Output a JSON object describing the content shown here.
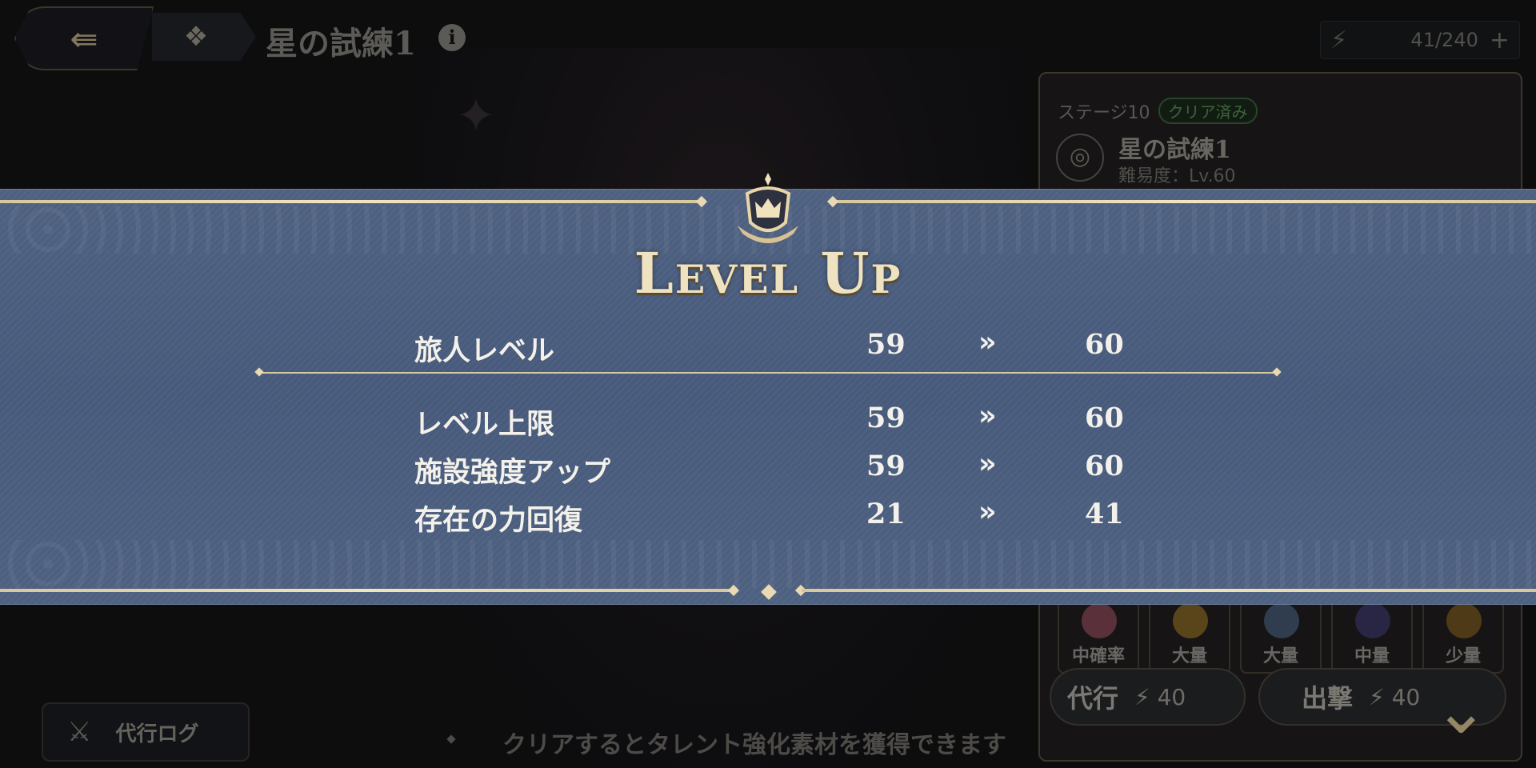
{
  "header": {
    "back_icon": "back-arrow-icon",
    "menu_icon": "grid-menu-icon",
    "title": "星の試練1",
    "info_icon": "info-icon",
    "stamina": {
      "icon": "lightning-icon",
      "value": "41/240",
      "plus": "+"
    }
  },
  "stage_panel": {
    "stage_label": "ステージ10",
    "status_badge": "クリア済み",
    "name": "星の試練1",
    "difficulty": "難易度：Lv.60",
    "rewards": [
      {
        "label": "中確率",
        "color": "#8b4b5a"
      },
      {
        "label": "大量",
        "color": "#8a6a2a"
      },
      {
        "label": "大量",
        "color": "#4a5e78"
      },
      {
        "label": "中量",
        "color": "#3e3a6a"
      },
      {
        "label": "少量",
        "color": "#7a5a24"
      }
    ],
    "auto_button": {
      "label": "代行",
      "cost": "40"
    },
    "sortie_button": {
      "label": "出撃",
      "cost": "40"
    }
  },
  "bottom": {
    "log_button": "代行ログ",
    "hint": "クリアするとタレント強化素材を獲得できます"
  },
  "level_up": {
    "title": "Level Up",
    "rows": [
      {
        "label": "旅人レベル",
        "from": "59",
        "to": "60"
      },
      {
        "label": "レベル上限",
        "from": "59",
        "to": "60"
      },
      {
        "label": "施設強度アップ",
        "from": "59",
        "to": "60"
      },
      {
        "label": "存在の力回復",
        "from": "21",
        "to": "41"
      }
    ],
    "arrow": "»"
  },
  "colors": {
    "banner": "#4a5d7e",
    "gold": "#e9d9b2",
    "text": "#f3f1ea"
  }
}
